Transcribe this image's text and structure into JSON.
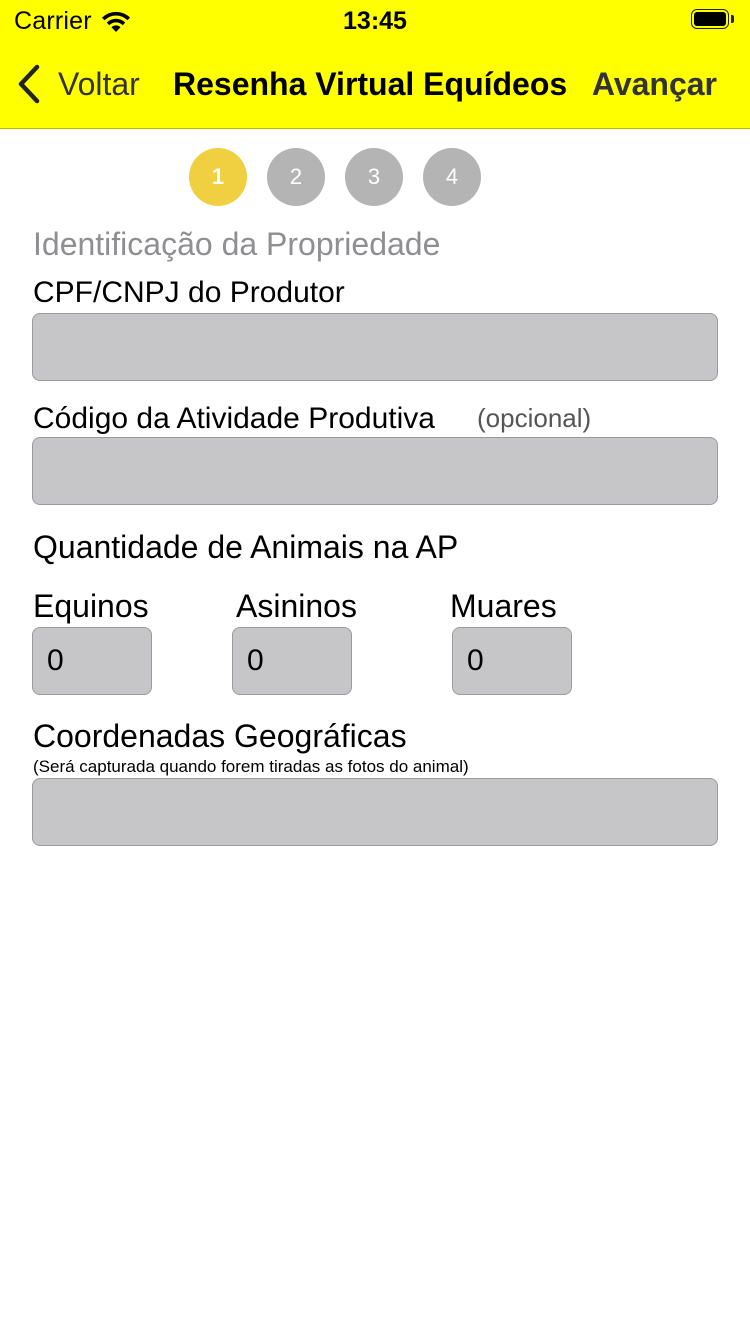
{
  "status_bar": {
    "carrier": "Carrier",
    "time": "13:45",
    "icons": [
      "wifi-icon",
      "battery-icon"
    ]
  },
  "nav": {
    "back_label": "Voltar",
    "back_icon": "chevron-left-icon",
    "title": "Resenha Virtual Equídeos",
    "next_label": "Avançar",
    "background_color": "#ffff00"
  },
  "stepper": {
    "steps": [
      "1",
      "2",
      "3",
      "4"
    ],
    "active_step": "1",
    "active_color": "#f0d040",
    "inactive_color": "#b4b4b4"
  },
  "form": {
    "section_title": "Identificação da Propriedade",
    "cpf_label": "CPF/CNPJ do Produtor",
    "cpf_value": "",
    "codigo_label": "Código da Atividade Produtiva",
    "codigo_optional": "(opcional)",
    "codigo_value": "",
    "quantidade_label": "Quantidade de Animais na AP",
    "equinos_label": "Equinos",
    "equinos_value": "0",
    "asininos_label": "Asininos",
    "asininos_value": "0",
    "muares_label": "Muares",
    "muares_value": "0",
    "coordenadas_label": "Coordenadas Geográficas",
    "coordenadas_note": "(Será capturada quando forem tiradas as fotos do animal)",
    "coordenadas_value": ""
  }
}
